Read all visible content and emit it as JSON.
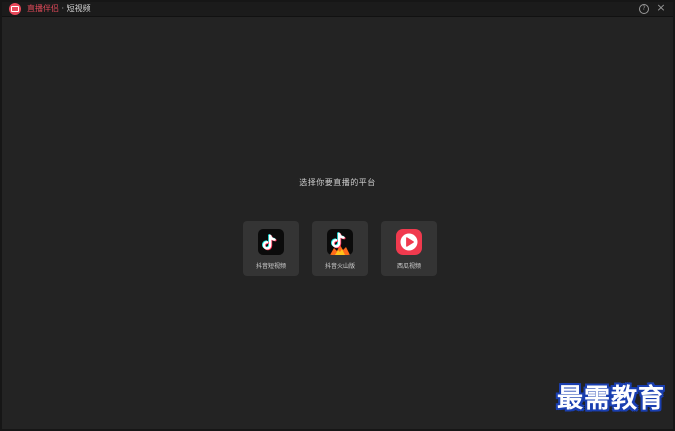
{
  "titlebar": {
    "app_name": "直播伴侣",
    "separator": " · ",
    "mode": "短视频"
  },
  "icons": {
    "help": "help-circle-icon",
    "close": "close-icon",
    "app_logo": "app-logo-icon"
  },
  "main": {
    "prompt": "选择你要直播的平台",
    "platforms": [
      {
        "label": "抖音短视频",
        "icon": "douyin-icon"
      },
      {
        "label": "抖音火山版",
        "icon": "douyin-huoshan-icon"
      },
      {
        "label": "西瓜视频",
        "icon": "xigua-video-icon"
      }
    ]
  },
  "watermark": {
    "text": "最需教育"
  },
  "colors": {
    "accent": "#e34a5a",
    "background": "#232323",
    "card": "#343434",
    "watermark_outline": "#1a3fb0"
  }
}
